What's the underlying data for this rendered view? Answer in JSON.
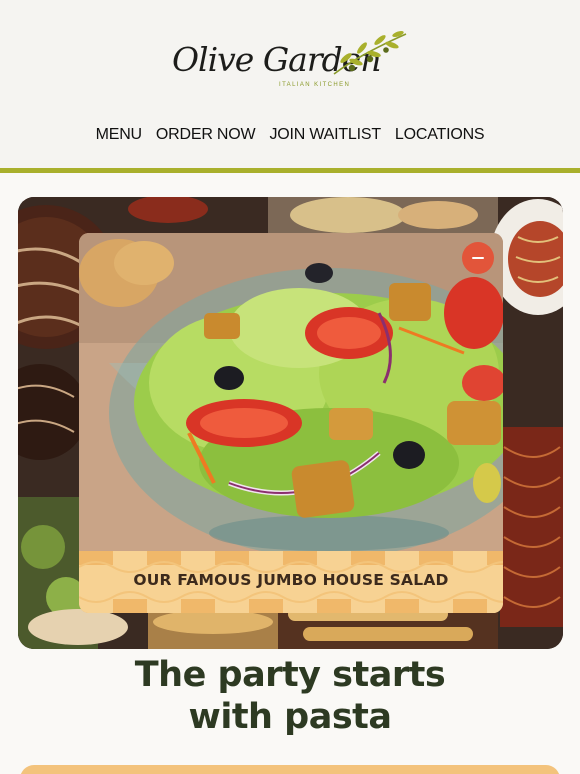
{
  "brand": {
    "name": "Olive Garden",
    "tagline": "ITALIAN KITCHEN",
    "accent_color": "#a9b02c"
  },
  "nav": {
    "items": [
      {
        "label": "MENU"
      },
      {
        "label": "ORDER NOW"
      },
      {
        "label": "JOIN WAITLIST"
      },
      {
        "label": "LOCATIONS"
      }
    ]
  },
  "hero": {
    "card_caption": "OUR FAMOUS JUMBO HOUSE SALAD",
    "close_icon": "minus-circle-icon",
    "close_color": "#e2553a"
  },
  "headline": {
    "line1": "The party starts",
    "line2": "with pasta"
  }
}
